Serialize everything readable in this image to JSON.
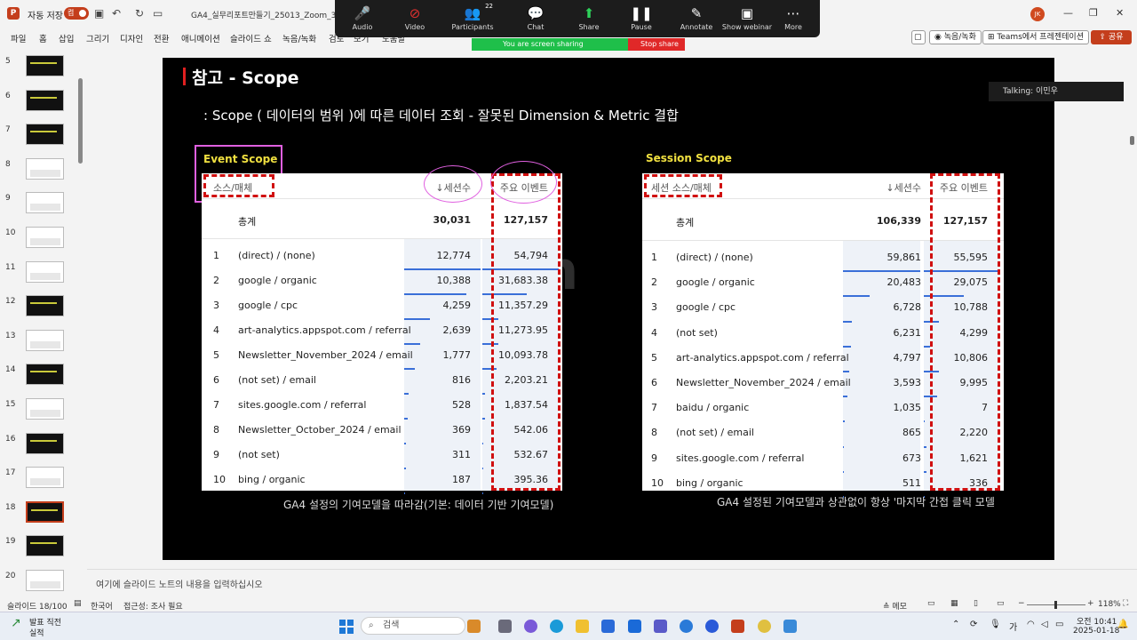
{
  "titlebar": {
    "autosave_label": "자동 저장",
    "autosave_state": "켬",
    "doc_title": "GA4_실무리포트만들기_25013_Zoom_3차 •",
    "avatar_initials": "JK"
  },
  "zoom": {
    "buttons": [
      {
        "label": "Audio",
        "icon": "mic-icon"
      },
      {
        "label": "Video",
        "icon": "video-off-icon"
      },
      {
        "label": "Participants",
        "icon": "participants-icon",
        "count": "22"
      },
      {
        "label": "Chat",
        "icon": "chat-icon"
      },
      {
        "label": "Share",
        "icon": "share-icon"
      },
      {
        "label": "Pause",
        "icon": "pause-icon"
      },
      {
        "label": "Annotate",
        "icon": "pen-icon"
      },
      {
        "label": "Show webinar",
        "icon": "webinar-icon"
      },
      {
        "label": "More",
        "icon": "more-icon"
      }
    ],
    "sharing_text": "You are screen sharing",
    "stop_share": "Stop share",
    "talking": "Talking: 이민우"
  },
  "ribbon": {
    "tabs": [
      "파일",
      "홈",
      "삽입",
      "그리기",
      "디자인",
      "전환",
      "애니메이션",
      "슬라이드 쇼",
      "녹음/녹화",
      "검토",
      "보기",
      "도움말"
    ],
    "record_btn": "녹음/녹화",
    "teams_btn": "Teams에서 프레젠테이션",
    "share_btn": "공유"
  },
  "thumbnails": {
    "numbers": [
      "5",
      "6",
      "7",
      "8",
      "9",
      "10",
      "11",
      "12",
      "13",
      "14",
      "15",
      "16",
      "17",
      "18",
      "19",
      "20"
    ],
    "selected": "18"
  },
  "slide": {
    "title": "참고 - Scope",
    "subtitle": ": Scope ( 데이터의 범위 )에 따른 데이터 조회 - 잘못된 Dimension & Metric 결합",
    "watermark": "inflearn",
    "event": {
      "label": "Event Scope",
      "col_dim": "소스/매체",
      "col_sessions": "↓세션수",
      "col_key_events": "주요 이벤트",
      "total_label": "총계",
      "total_sessions": "30,031",
      "total_key": "127,157",
      "rows": [
        {
          "n": "1",
          "src": "(direct) / (none)",
          "s": "12,774",
          "k": "54,794"
        },
        {
          "n": "2",
          "src": "google / organic",
          "s": "10,388",
          "k": "31,683.38"
        },
        {
          "n": "3",
          "src": "google / cpc",
          "s": "4,259",
          "k": "11,357.29"
        },
        {
          "n": "4",
          "src": "art-analytics.appspot.com / referral",
          "s": "2,639",
          "k": "11,273.95"
        },
        {
          "n": "5",
          "src": "Newsletter_November_2024 / email",
          "s": "1,777",
          "k": "10,093.78"
        },
        {
          "n": "6",
          "src": "(not set) / email",
          "s": "816",
          "k": "2,203.21"
        },
        {
          "n": "7",
          "src": "sites.google.com / referral",
          "s": "528",
          "k": "1,837.54"
        },
        {
          "n": "8",
          "src": "Newsletter_October_2024 / email",
          "s": "369",
          "k": "542.06"
        },
        {
          "n": "9",
          "src": "(not set)",
          "s": "311",
          "k": "532.67"
        },
        {
          "n": "10",
          "src": "bing / organic",
          "s": "187",
          "k": "395.36"
        }
      ],
      "caption": "GA4 설정의 기여모델을 따라감(기본: 데이터 기반 기여모델)"
    },
    "session": {
      "label": "Session Scope",
      "col_dim": "세션 소스/매체",
      "col_sessions": "↓세션수",
      "col_key_events": "주요 이벤트",
      "total_label": "총계",
      "total_sessions": "106,339",
      "total_key": "127,157",
      "rows": [
        {
          "n": "1",
          "src": "(direct) / (none)",
          "s": "59,861",
          "k": "55,595"
        },
        {
          "n": "2",
          "src": "google / organic",
          "s": "20,483",
          "k": "29,075"
        },
        {
          "n": "3",
          "src": "google / cpc",
          "s": "6,728",
          "k": "10,788"
        },
        {
          "n": "4",
          "src": "(not set)",
          "s": "6,231",
          "k": "4,299"
        },
        {
          "n": "5",
          "src": "art-analytics.appspot.com / referral",
          "s": "4,797",
          "k": "10,806"
        },
        {
          "n": "6",
          "src": "Newsletter_November_2024 / email",
          "s": "3,593",
          "k": "9,995"
        },
        {
          "n": "7",
          "src": "baidu / organic",
          "s": "1,035",
          "k": "7"
        },
        {
          "n": "8",
          "src": "(not set) / email",
          "s": "865",
          "k": "2,220"
        },
        {
          "n": "9",
          "src": "sites.google.com / referral",
          "s": "673",
          "k": "1,621"
        },
        {
          "n": "10",
          "src": "bing / organic",
          "s": "511",
          "k": "336"
        }
      ],
      "caption": "GA4 설정된 기여모델과 상관없이 항상 '마지막 간접 클릭 모델"
    }
  },
  "notes": {
    "placeholder": "여기에 슬라이드 노트의 내용을 입력하십시오"
  },
  "status": {
    "slide_count": "슬라이드 18/100",
    "language": "한국어",
    "accessibility": "접근성: 조사 필요",
    "notes_btn": "메모",
    "zoom": "118%"
  },
  "taskbar": {
    "weather_line1": "발표 직전",
    "weather_line2": "실적",
    "search": "검색",
    "ime": "가",
    "time": "오전 10:41",
    "date": "2025-01-18"
  },
  "colors": {
    "accent": "#c43e1c",
    "dash": "#d01010",
    "highlight": "#f0e040",
    "annotation": "#e060e0"
  }
}
